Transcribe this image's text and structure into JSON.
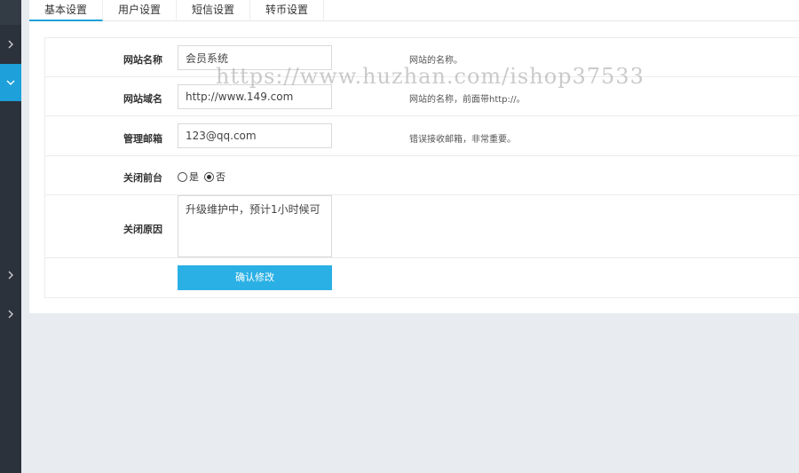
{
  "tabs": [
    {
      "label": "基本设置"
    },
    {
      "label": "用户设置"
    },
    {
      "label": "短信设置"
    },
    {
      "label": "转币设置"
    }
  ],
  "form": {
    "site_name": {
      "label": "网站名称",
      "value": "会员系统",
      "hint": "网站的名称。"
    },
    "site_domain": {
      "label": "网站域名",
      "value": "http://www.149.com",
      "hint": "网站的名称，前面带http://。"
    },
    "admin_email": {
      "label": "管理邮箱",
      "value": "123@qq.com",
      "hint": "错误接收邮箱，非常重要。"
    },
    "close_site": {
      "label": "关闭前台",
      "options": [
        {
          "label": "是",
          "checked": false
        },
        {
          "label": "否",
          "checked": true
        }
      ]
    },
    "close_reason": {
      "label": "关闭原因",
      "value": "升级维护中，预计1小时候可"
    },
    "submit_label": "确认修改"
  },
  "watermark": "https://www.huzhan.com/ishop37533",
  "colors": {
    "accent": "#1ea0da",
    "sidebar": "#2b323b",
    "button": "#2ab0e5",
    "background": "#e8ebef"
  }
}
